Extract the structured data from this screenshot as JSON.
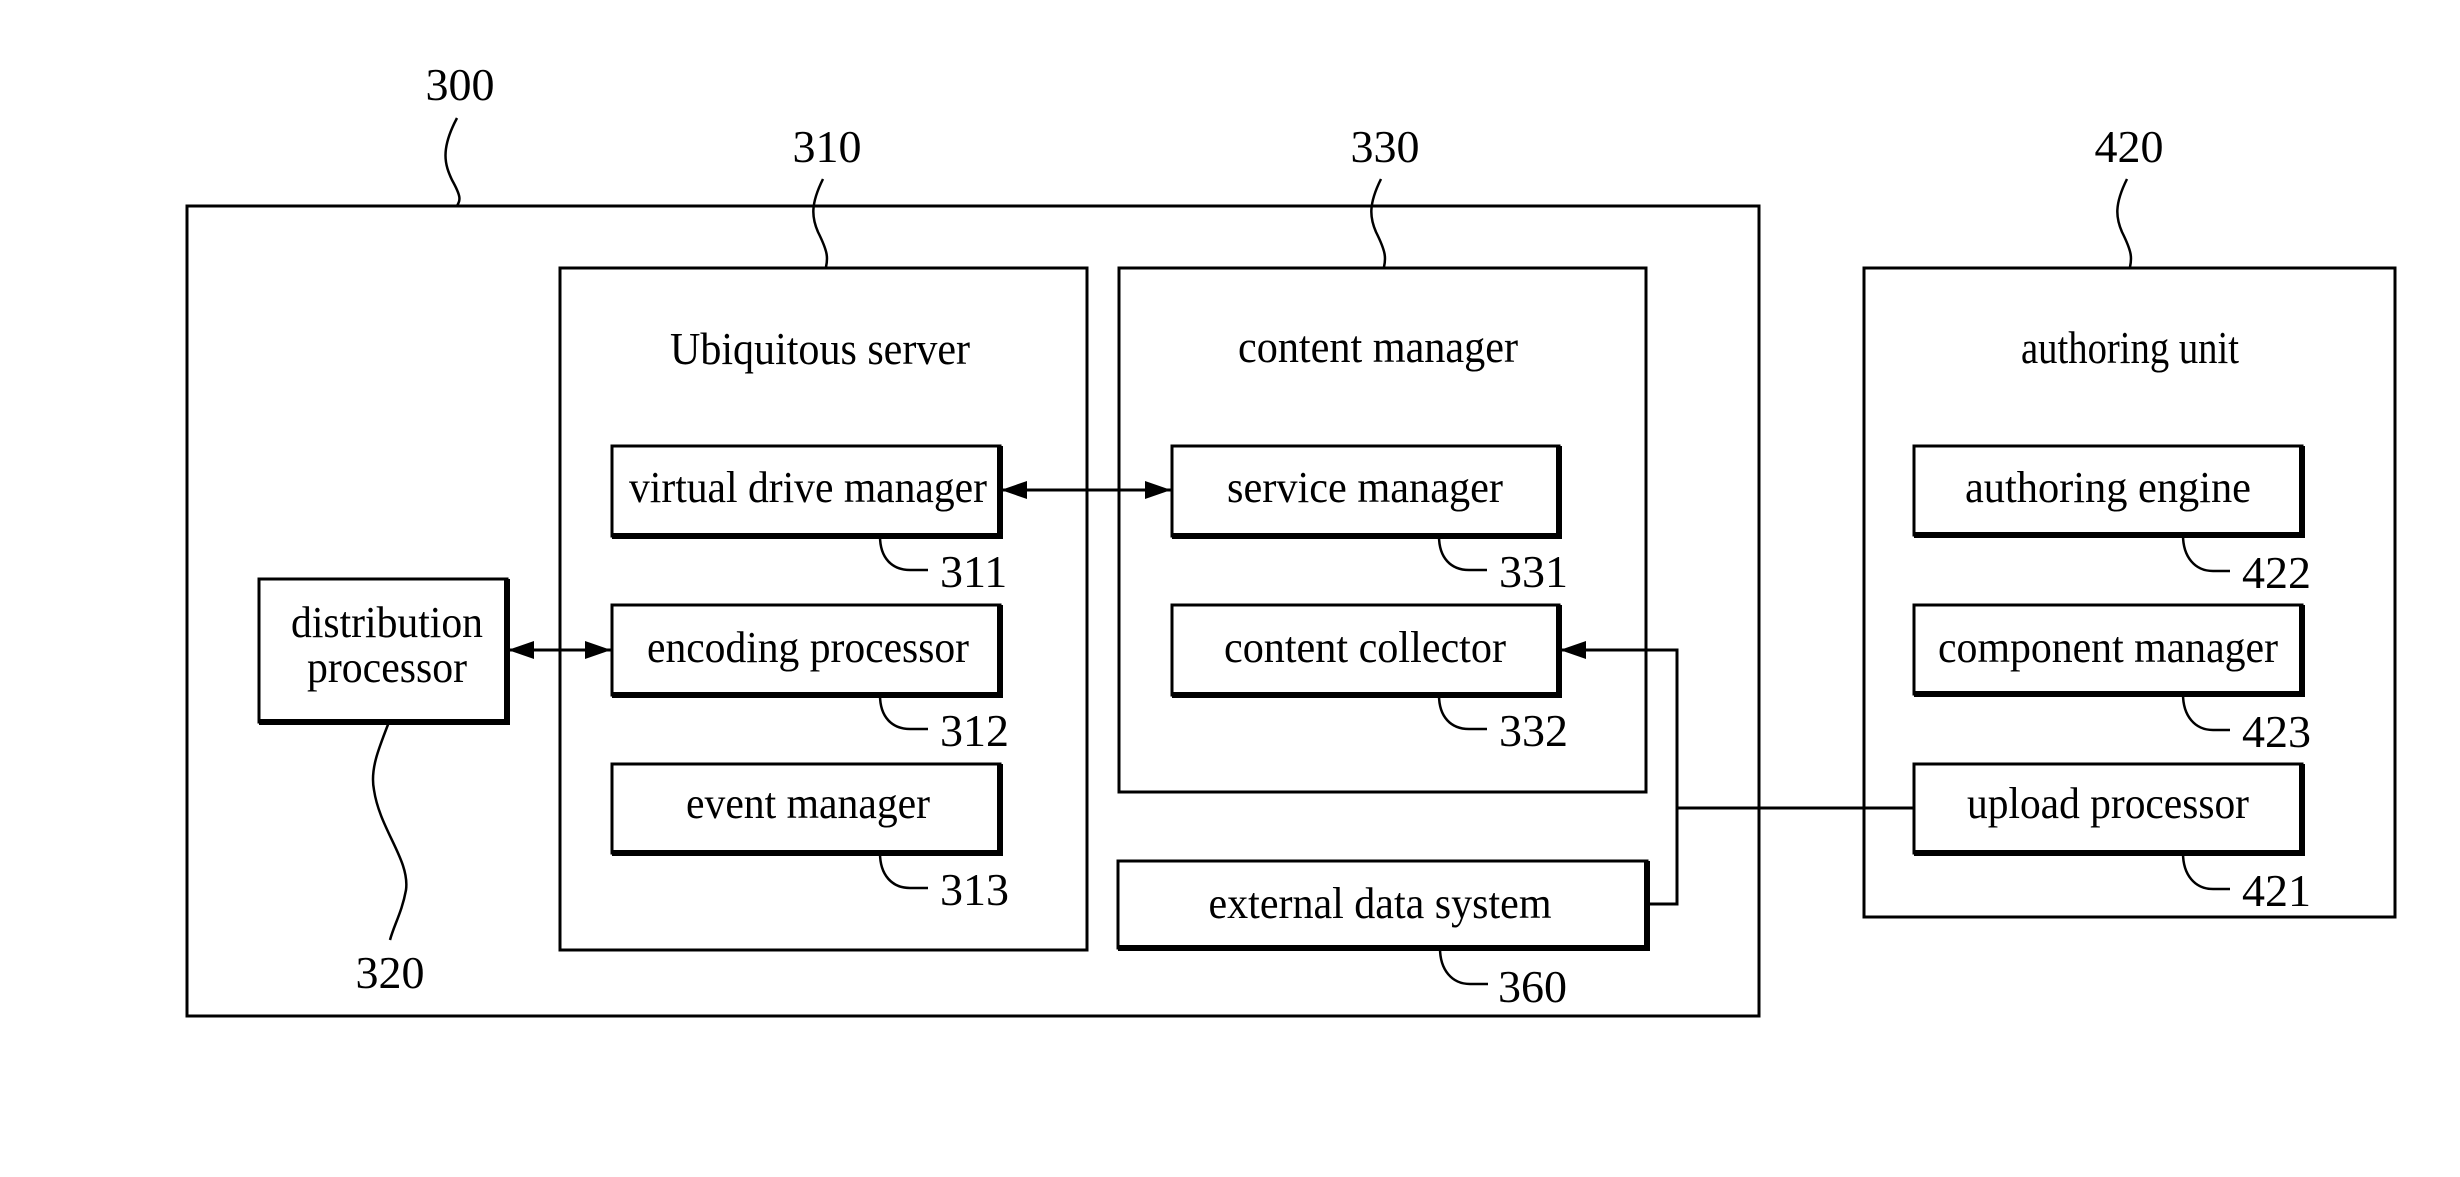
{
  "figure": {
    "system": {
      "ref": "300"
    },
    "ubiquitous_server": {
      "ref": "310",
      "title": "Ubiquitous server",
      "components": [
        {
          "ref": "311",
          "label": "virtual drive manager"
        },
        {
          "ref": "312",
          "label": "encoding processor"
        },
        {
          "ref": "313",
          "label": "event manager"
        }
      ]
    },
    "distribution_processor": {
      "ref": "320",
      "label_lines": [
        "distribution",
        "processor"
      ]
    },
    "content_manager": {
      "ref": "330",
      "title": "content manager",
      "components": [
        {
          "ref": "331",
          "label": "service manager"
        },
        {
          "ref": "332",
          "label": "content collector"
        }
      ]
    },
    "external_data_system": {
      "ref": "360",
      "label": "external data system"
    },
    "authoring_unit": {
      "ref": "420",
      "title": "authoring unit",
      "components": [
        {
          "ref": "422",
          "label": "authoring engine"
        },
        {
          "ref": "423",
          "label": "component manager"
        },
        {
          "ref": "421",
          "label": "upload processor"
        }
      ]
    },
    "connections": [
      {
        "from": "distribution processor",
        "to": "encoding processor",
        "type": "bidirectional"
      },
      {
        "from": "virtual drive manager",
        "to": "service manager",
        "type": "bidirectional"
      },
      {
        "from": "upload processor",
        "to": "content collector",
        "type": "directed"
      },
      {
        "from": "external data system",
        "to": "content collector",
        "type": "directed"
      }
    ]
  }
}
